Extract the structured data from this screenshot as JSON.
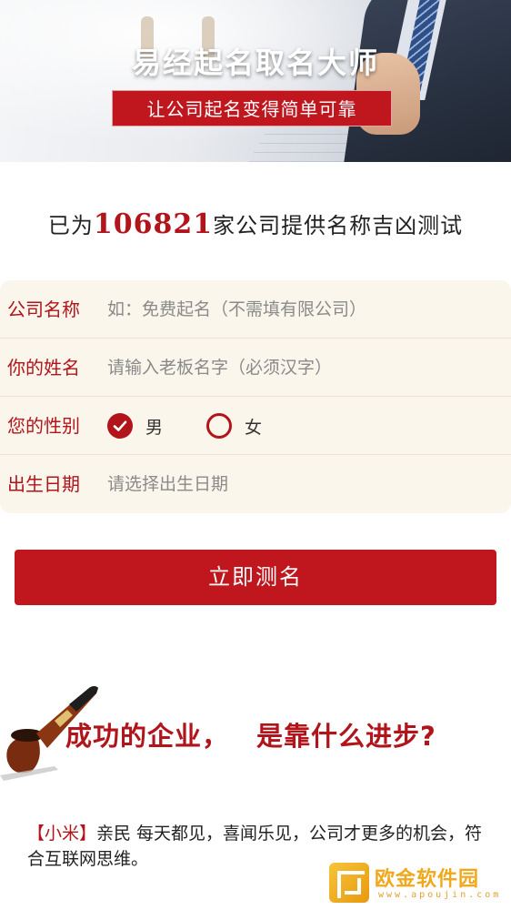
{
  "banner": {
    "title": "易经起名取名大师",
    "subtitle": "让公司起名变得简单可靠"
  },
  "stats": {
    "prefix": "已为",
    "count": "106821",
    "suffix": "家公司提供名称吉凶测试"
  },
  "form": {
    "company": {
      "label": "公司名称",
      "placeholder": "如：免费起名（不需填有限公司）"
    },
    "name": {
      "label": "你的姓名",
      "placeholder": "请输入老板名字（必须汉字）"
    },
    "gender": {
      "label": "您的性别",
      "options": [
        {
          "label": "男",
          "selected": true
        },
        {
          "label": "女",
          "selected": false
        }
      ]
    },
    "birthdate": {
      "label": "出生日期",
      "placeholder": "请选择出生日期"
    }
  },
  "submit_label": "立即测名",
  "section": {
    "title_part1": "成功的企业，",
    "title_part2": "是靠什么进步?",
    "tag": "【小米】",
    "body": "亲民 每天都见，喜闻乐见，公司才更多的机会，符合互联网思维。"
  },
  "watermark": {
    "text": "欧金软件园",
    "url": "www.apoujin.com"
  },
  "colors": {
    "accent": "#b1141b",
    "button": "#c0161e",
    "form_bg": "#fbf6ec"
  }
}
